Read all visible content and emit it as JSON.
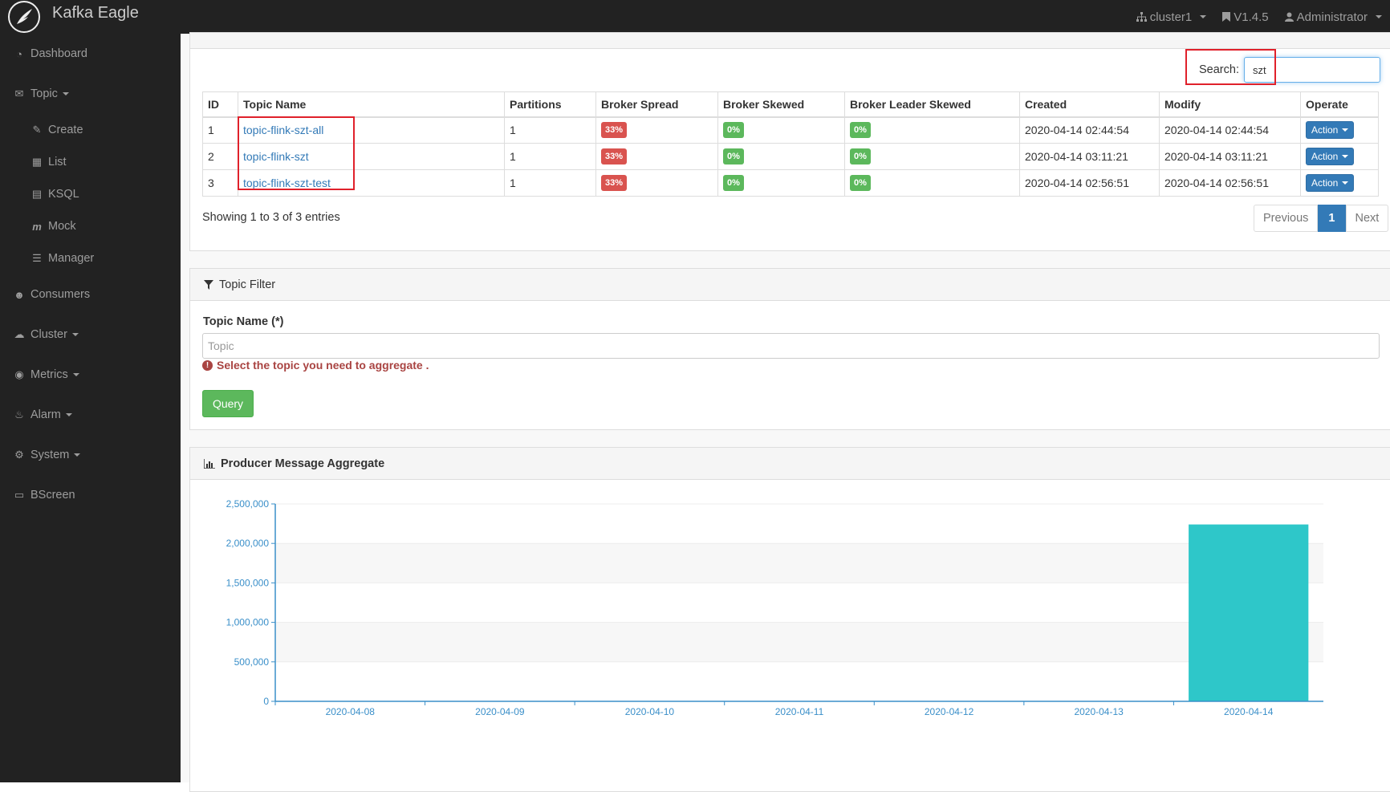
{
  "app": {
    "title": "Kafka Eagle"
  },
  "navbar": {
    "cluster": "cluster1",
    "version": "V1.4.5",
    "user": "Administrator"
  },
  "sidebar": {
    "items": [
      {
        "label": "Dashboard",
        "icon": "dashboard-icon"
      },
      {
        "label": "Topic",
        "icon": "comments-icon"
      },
      {
        "label": "Create",
        "icon": "edit-icon"
      },
      {
        "label": "List",
        "icon": "table-icon"
      },
      {
        "label": "KSQL",
        "icon": "file-icon"
      },
      {
        "label": "Mock",
        "icon": "mock-icon"
      },
      {
        "label": "Manager",
        "icon": "tasks-icon"
      },
      {
        "label": "Consumers",
        "icon": "users-icon"
      },
      {
        "label": "Cluster",
        "icon": "cloud-icon"
      },
      {
        "label": "Metrics",
        "icon": "eye-icon"
      },
      {
        "label": "Alarm",
        "icon": "bell-icon"
      },
      {
        "label": "System",
        "icon": "gear-icon"
      },
      {
        "label": "BScreen",
        "icon": "desktop-icon"
      }
    ]
  },
  "topic_list": {
    "search_label": "Search:",
    "search_value": "szt",
    "columns": [
      "ID",
      "Topic Name",
      "Partitions",
      "Broker Spread",
      "Broker Skewed",
      "Broker Leader Skewed",
      "Created",
      "Modify",
      "Operate"
    ],
    "rows": [
      {
        "id": "1",
        "name": "topic-flink-szt-all",
        "partitions": "1",
        "spread": "33%",
        "skewed": "0%",
        "leader_skewed": "0%",
        "created": "2020-04-14 02:44:54",
        "modify": "2020-04-14 02:44:54",
        "action": "Action"
      },
      {
        "id": "2",
        "name": "topic-flink-szt",
        "partitions": "1",
        "spread": "33%",
        "skewed": "0%",
        "leader_skewed": "0%",
        "created": "2020-04-14 03:11:21",
        "modify": "2020-04-14 03:11:21",
        "action": "Action"
      },
      {
        "id": "3",
        "name": "topic-flink-szt-test",
        "partitions": "1",
        "spread": "33%",
        "skewed": "0%",
        "leader_skewed": "0%",
        "created": "2020-04-14 02:56:51",
        "modify": "2020-04-14 02:56:51",
        "action": "Action"
      }
    ],
    "showing": "Showing 1 to 3 of 3 entries",
    "pager": {
      "previous": "Previous",
      "current": "1",
      "next": "Next"
    }
  },
  "topic_filter": {
    "title": "Topic Filter",
    "field_label": "Topic Name (*)",
    "placeholder": "Topic",
    "hint": "Select the topic you need to aggregate .",
    "query": "Query"
  },
  "aggregate": {
    "title": "Producer Message Aggregate"
  },
  "colors": {
    "bar": "#2ec7c9",
    "axis": "#3a8fc9",
    "badge_red": "#d9534f",
    "badge_green": "#5cb85c",
    "primary": "#337ab7"
  },
  "chart_data": {
    "type": "bar",
    "categories": [
      "2020-04-08",
      "2020-04-09",
      "2020-04-10",
      "2020-04-11",
      "2020-04-12",
      "2020-04-13",
      "2020-04-14"
    ],
    "values": [
      0,
      0,
      0,
      0,
      0,
      0,
      2240000
    ],
    "ylim": [
      0,
      2500000
    ],
    "yticks": [
      "0",
      "500,000",
      "1,000,000",
      "1,500,000",
      "2,000,000",
      "2,500,000"
    ],
    "grid": true
  }
}
